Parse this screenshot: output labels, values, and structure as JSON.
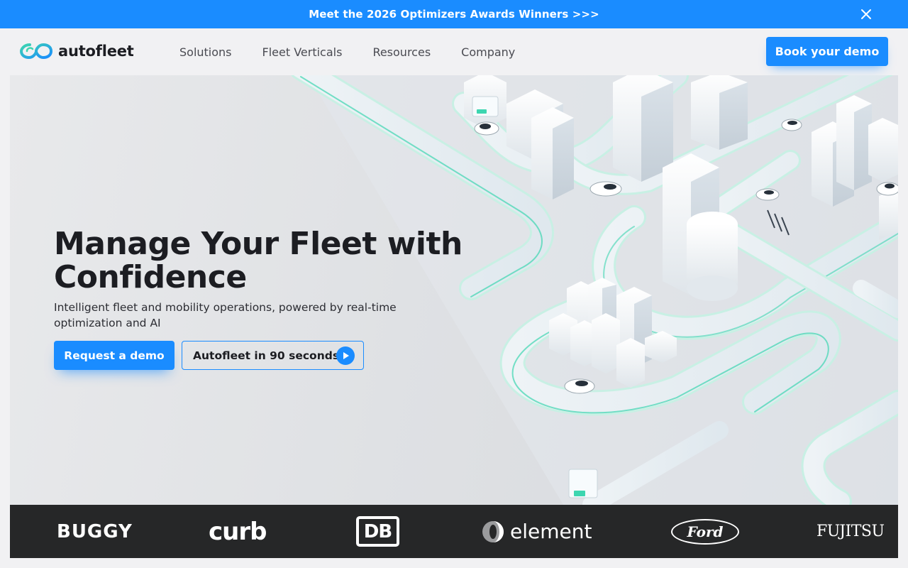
{
  "announcement": {
    "text": "Meet the 2026 Optimizers Awards Winners >>>",
    "close_icon": "close-icon"
  },
  "header": {
    "logo_text": "autofleet",
    "nav": [
      {
        "label": "Solutions"
      },
      {
        "label": "Fleet Verticals"
      },
      {
        "label": "Resources"
      },
      {
        "label": "Company"
      }
    ],
    "cta_label": "Book your demo"
  },
  "hero": {
    "title": "Manage Your Fleet with Confidence",
    "subtitle": "Intelligent fleet and mobility operations, powered by real-time optimization and AI",
    "primary_cta": "Request a demo",
    "video_cta": "Autofleet in 90 seconds",
    "video_icon": "play-icon"
  },
  "partners": {
    "logos": [
      {
        "name": "BUGGY"
      },
      {
        "name": "curb"
      },
      {
        "name": "DB"
      },
      {
        "name": "element"
      },
      {
        "name": "Ford"
      },
      {
        "name": "FUJITSU"
      }
    ]
  },
  "colors": {
    "accent": "#1a8cff",
    "text": "#1c1d22",
    "logo_strip": "#262728",
    "teal": "#3dd6b0"
  }
}
